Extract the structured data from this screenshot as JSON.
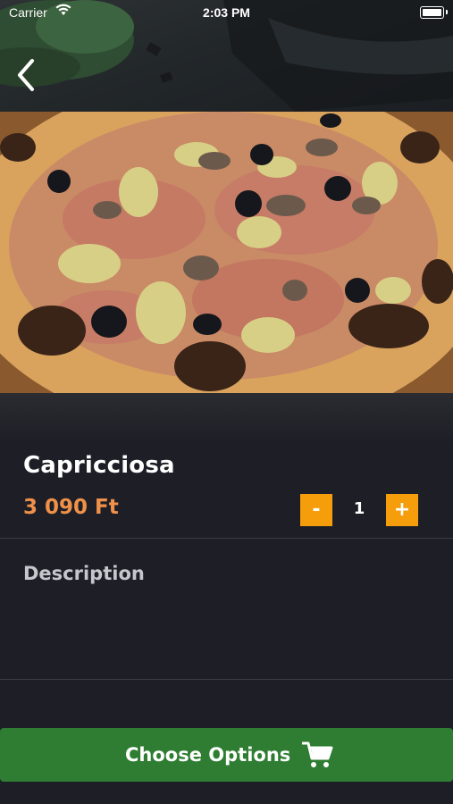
{
  "status_bar": {
    "carrier": "Carrier",
    "time": "2:03 PM"
  },
  "product": {
    "name": "Capricciosa",
    "price": "3 090 Ft"
  },
  "quantity": {
    "minus_label": "-",
    "value": "1",
    "plus_label": "+"
  },
  "description": {
    "label": "Description"
  },
  "cta": {
    "label": "Choose Options"
  },
  "colors": {
    "accent_orange": "#f59d0a",
    "price_orange": "#f0914a",
    "cta_green": "#2e7d32",
    "background": "#1e1f26"
  }
}
